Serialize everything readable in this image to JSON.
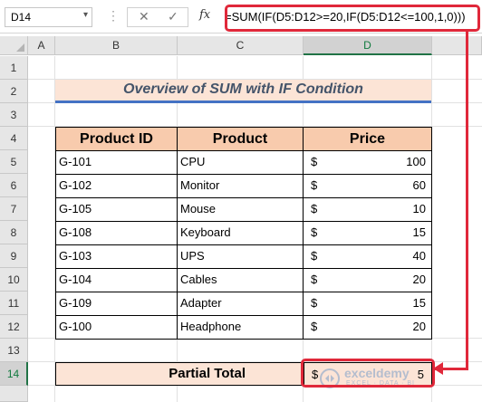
{
  "formula_bar": {
    "name_box": "D14",
    "name_box_arrow": "▾",
    "dots": "⋮",
    "cancel": "✕",
    "enter": "✓",
    "fx": "fx",
    "formula": "=SUM(IF(D5:D12>=20,IF(D5:D12<=100,1,0)))"
  },
  "columns": [
    "A",
    "B",
    "C",
    "D"
  ],
  "selected_column": "D",
  "rows": [
    "1",
    "2",
    "3",
    "4",
    "5",
    "6",
    "7",
    "8",
    "9",
    "10",
    "11",
    "12",
    "13",
    "14"
  ],
  "selected_row": "14",
  "title": "Overview of SUM with IF Condition",
  "table": {
    "headers": [
      "Product ID",
      "Product",
      "Price"
    ],
    "currency": "$",
    "rows": [
      {
        "id": "G-101",
        "product": "CPU",
        "price": "100"
      },
      {
        "id": "G-102",
        "product": "Monitor",
        "price": "60"
      },
      {
        "id": "G-105",
        "product": "Mouse",
        "price": "10"
      },
      {
        "id": "G-108",
        "product": "Keyboard",
        "price": "15"
      },
      {
        "id": "G-103",
        "product": "UPS",
        "price": "40"
      },
      {
        "id": "G-104",
        "product": "Cables",
        "price": "20"
      },
      {
        "id": "G-109",
        "product": "Adapter",
        "price": "15"
      },
      {
        "id": "G-100",
        "product": "Headphone",
        "price": "20"
      }
    ]
  },
  "total": {
    "label": "Partial Total",
    "currency": "$",
    "value": "5"
  },
  "watermark": {
    "name": "exceldemy",
    "tagline": "EXCEL · DATA · BI"
  },
  "colors": {
    "highlight": "#e0283a",
    "header_fill": "#f8cbad",
    "title_fill": "#fce4d6",
    "accent_green": "#217346"
  }
}
